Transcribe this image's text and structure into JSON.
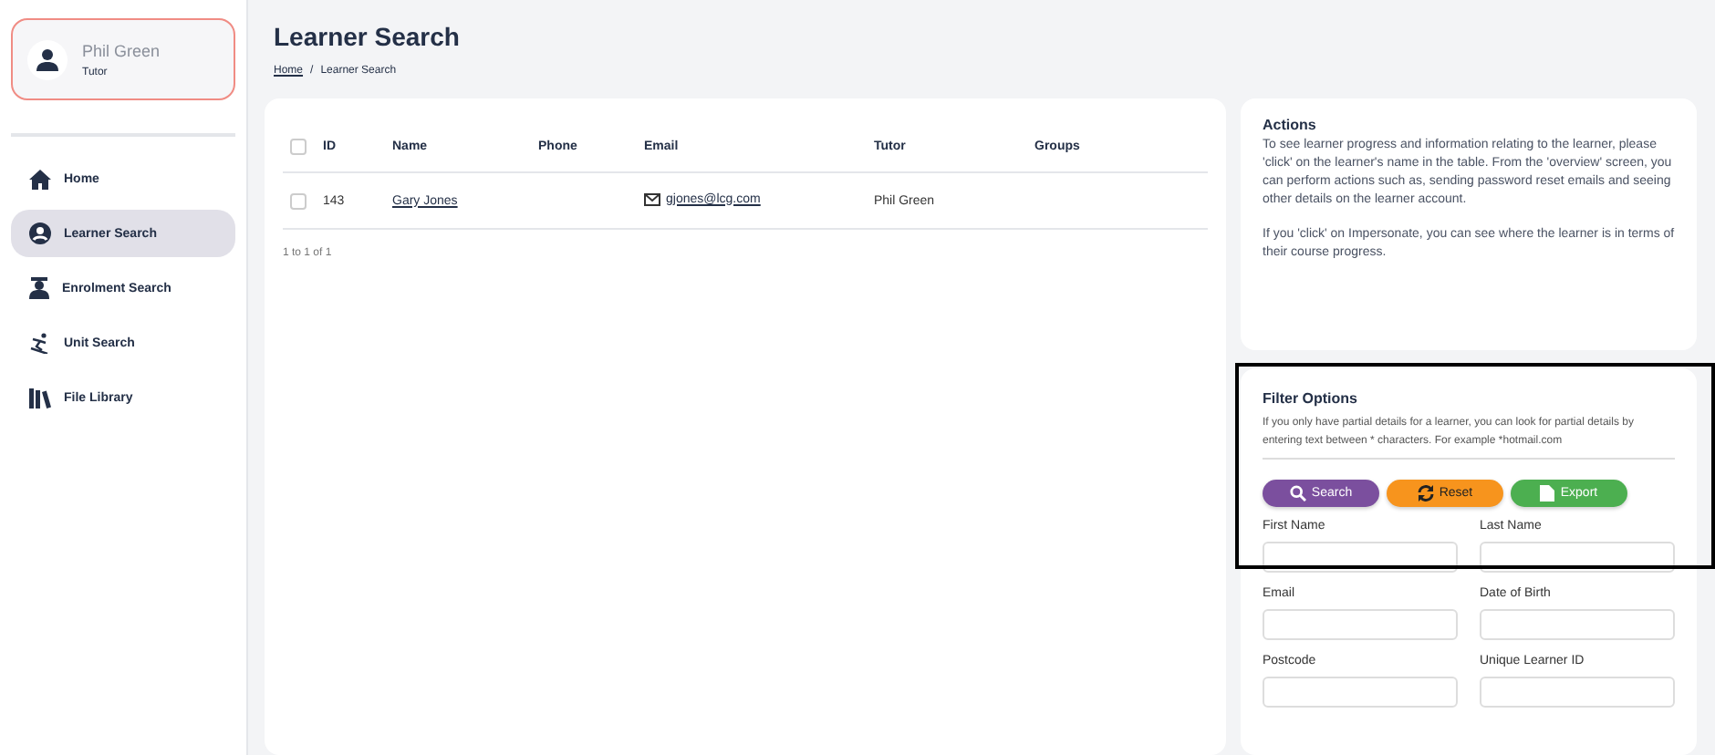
{
  "user": {
    "name": "Phil Green",
    "role": "Tutor"
  },
  "nav": [
    {
      "label": "Home",
      "kind": "home",
      "selected": false
    },
    {
      "label": "Learner Search",
      "kind": "learner",
      "selected": true
    },
    {
      "label": "Enrolment Search",
      "kind": "enrolment",
      "selected": false
    },
    {
      "label": "Unit Search",
      "kind": "unit",
      "selected": false
    },
    {
      "label": "File Library",
      "kind": "library",
      "selected": false
    }
  ],
  "page": {
    "title": "Learner Search",
    "breadcrumb": [
      "Home",
      "Learner Search"
    ],
    "separator": "/"
  },
  "table": {
    "select_all_checked": false,
    "columns": [
      "ID",
      "Name",
      "Phone",
      "Email",
      "Tutor",
      "Groups"
    ],
    "rows": [
      {
        "checked": false,
        "id": "143",
        "name": "Gary Jones",
        "phone": "",
        "email": "gjones@lcg.com",
        "tutor": "Phil Green",
        "groups": ""
      }
    ],
    "footer": "1 to 1 of 1"
  },
  "actions": {
    "title": "Actions",
    "paragraphs": [
      "To see learner progress and information relating to the learner, please 'click' on the learner's name in the table. From the 'overview' screen, you can perform actions such as, sending password reset emails and seeing other details on the learner account.",
      "If you 'click' on Impersonate, you can see where the learner is in terms of their course progress."
    ]
  },
  "filter": {
    "title": "Filter Options",
    "hint": "If you only have partial details for a learner, you can look for partial details by entering text between * characters. For example *hotmail.com",
    "buttons": [
      {
        "label": "Search",
        "kind": "search"
      },
      {
        "label": "Reset",
        "kind": "reset"
      },
      {
        "label": "Export",
        "kind": "export"
      }
    ],
    "fields": [
      "First Name",
      "Last Name",
      "Email",
      "Date of Birth",
      "Postcode",
      "Unique Learner ID"
    ]
  }
}
